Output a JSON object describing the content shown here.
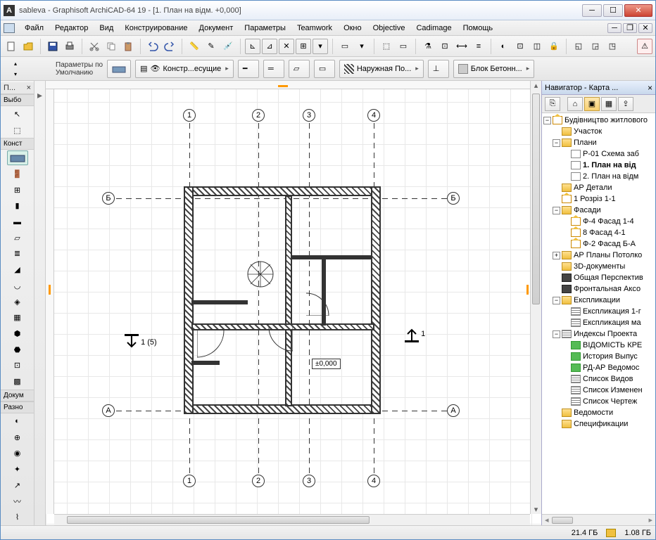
{
  "title": "sableva - Graphisoft ArchiCAD-64 19 - [1. План на відм. +0,000]",
  "menu": [
    "Файл",
    "Редактор",
    "Вид",
    "Конструирование",
    "Документ",
    "Параметры",
    "Teamwork",
    "Окно",
    "Objective",
    "Cadimage",
    "Помощь"
  ],
  "options": {
    "defaults_label": "Параметры по\nУмолчанию",
    "layer_label": "Констр...есущие",
    "surface_label": "Наружная По...",
    "material_label": "Блок Бетонн..."
  },
  "toolbox": {
    "header": "П...",
    "section_select": "Выбо",
    "section_construct": "Конст",
    "section_document": "Докум",
    "section_misc": "Разно"
  },
  "canvas": {
    "axes_h": [
      "1",
      "2",
      "3",
      "4"
    ],
    "axes_v": [
      "Б",
      "А"
    ],
    "section_left": "1 (5)",
    "section_right": "1",
    "elevation": "±0,000"
  },
  "navigator": {
    "title": "Навигатор - Карта ...",
    "root": "Будівництво житлового",
    "items": {
      "uchastok": "Участок",
      "plany": "Плани",
      "p01": "Р-01 Схема заб",
      "plan1": "1. План на від",
      "plan2": "2. План на відм",
      "ardetali": "АР Детали",
      "rozriz": "1 Розріз 1-1",
      "fasady": "Фасади",
      "f4": "Ф-4 Фасад 1-4",
      "f8": "8 Фасад 4-1",
      "f2": "Ф-2 Фасад Б-А",
      "arplany": "АР Планы Потолко",
      "3d": "3D-документы",
      "persp": "Общая Перспектив",
      "axon": "Фронтальная Аксо",
      "expl": "Експликации",
      "expl1": "Експликация 1-г",
      "expl2": "Експликация ма",
      "indexes": "Индексы Проекта",
      "vidomist": "ВІДОМІСТЬ КРЕ",
      "history": "История Выпус",
      "rdar": "РД-АР Ведомос",
      "spvid": "Список Видов",
      "spizm": "Список Изменен",
      "spcher": "Список Чертеж",
      "vedom": "Ведомости",
      "spec": "Спецификации"
    }
  },
  "status": {
    "left": "21.4 ГБ",
    "right": "1.08 ГБ"
  }
}
